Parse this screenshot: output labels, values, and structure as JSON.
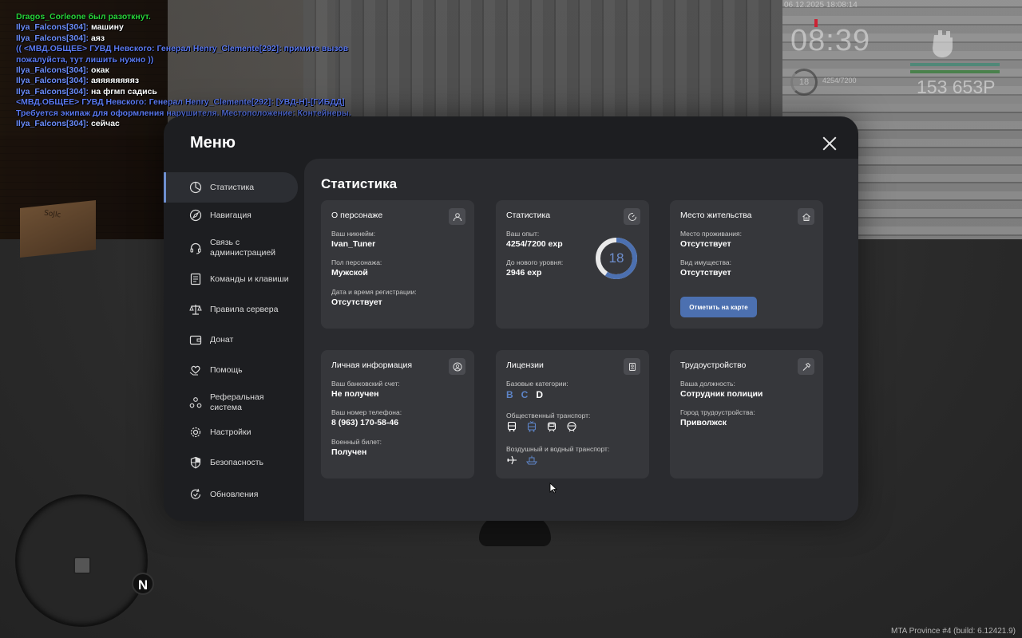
{
  "chat": [
    {
      "segments": [
        {
          "text": "Dragos_Corleone был разоткнут.",
          "color": "green"
        }
      ]
    },
    {
      "segments": [
        {
          "text": "Ilya_Falcons[304]: ",
          "color": "blue"
        },
        {
          "text": "машину",
          "color": "white"
        }
      ]
    },
    {
      "segments": [
        {
          "text": "Ilya_Falcons[304]: ",
          "color": "blue"
        },
        {
          "text": "аяз",
          "color": "white"
        }
      ]
    },
    {
      "segments": [
        {
          "text": "(( <МВД.ОБЩЕЕ> ГУВД Невского: Генерал Henry_Clemente[292]: примите вызов",
          "color": "gov"
        }
      ]
    },
    {
      "segments": [
        {
          "text": "пожалуйста, тут лишить нужно ))",
          "color": "gov"
        }
      ]
    },
    {
      "segments": [
        {
          "text": "Ilya_Falcons[304]: ",
          "color": "blue"
        },
        {
          "text": "окак",
          "color": "white"
        }
      ]
    },
    {
      "segments": [
        {
          "text": "Ilya_Falcons[304]: ",
          "color": "blue"
        },
        {
          "text": "аяяяяяяяяз",
          "color": "white"
        }
      ]
    },
    {
      "segments": [
        {
          "text": "Ilya_Falcons[304]: ",
          "color": "blue"
        },
        {
          "text": "на фгмп садись",
          "color": "white"
        }
      ]
    },
    {
      "segments": [
        {
          "text": "<МВД.ОБЩЕЕ> ГУВД Невского: Генерал Henry_Clemente[292]: [УВД-Н]-[ГИБДД]",
          "color": "gov"
        }
      ]
    },
    {
      "segments": [
        {
          "text": "Требуется экипаж для оформления нарушителя. Местоположение: Контейнеры.",
          "color": "gov"
        }
      ]
    },
    {
      "segments": [
        {
          "text": "Ilya_Falcons[304]: ",
          "color": "blue"
        },
        {
          "text": "сейчас",
          "color": "white"
        }
      ]
    }
  ],
  "hud": {
    "date": "06.12.2025 18:08:14",
    "time": "08:39",
    "level": "18",
    "exp": "4254/7200",
    "money": "153 653Р"
  },
  "build_info": "MTA Province #4 (build: 6.12421.9)",
  "scene": {
    "box_label": "SoJlc"
  },
  "menu": {
    "title": "Меню",
    "nav": [
      {
        "label": "Статистика",
        "icon": "pie-chart-icon",
        "active": true
      },
      {
        "label": "Навигация",
        "icon": "compass-icon"
      },
      {
        "label": "Связь с администрацией",
        "icon": "headset-icon"
      },
      {
        "label": "Команды и клавиши",
        "icon": "document-icon"
      },
      {
        "label": "Правила сервера",
        "icon": "scales-icon"
      },
      {
        "label": "Донат",
        "icon": "wallet-icon"
      },
      {
        "label": "Помощь",
        "icon": "heart-hand-icon"
      },
      {
        "label": "Реферальная система",
        "icon": "people-icon"
      },
      {
        "label": "Настройки",
        "icon": "gear-icon"
      },
      {
        "label": "Безопасность",
        "icon": "shield-icon"
      },
      {
        "label": "Обновления",
        "icon": "refresh-check-icon"
      }
    ],
    "content_title": "Статистика",
    "cards": {
      "character": {
        "title": "О персонаже",
        "fields": [
          {
            "label": "Ваш никнейм:",
            "value": "Ivan_Tuner"
          },
          {
            "label": "Пол персонажа:",
            "value": "Мужской"
          },
          {
            "label": "Дата и время регистрации:",
            "value": "Отсутствует"
          }
        ]
      },
      "stats": {
        "title": "Статистика",
        "exp_label": "Ваш опыт:",
        "exp_value": "4254/7200 exp",
        "next_label": "До нового уровня:",
        "next_value": "2946 exp",
        "level": "18",
        "exp_current": 4254,
        "exp_total": 7200
      },
      "residence": {
        "title": "Место жительства",
        "fields": [
          {
            "label": "Место проживания:",
            "value": "Отсутствует"
          },
          {
            "label": "Вид имущества:",
            "value": "Отсутствует"
          }
        ],
        "button": "Отметить на карте"
      },
      "personal": {
        "title": "Личная информация",
        "fields": [
          {
            "label": "Ваш банковский счет:",
            "value": "Не получен"
          },
          {
            "label": "Ваш номер телефона:",
            "value": "8 (963) 170-58-46"
          },
          {
            "label": "Военный билет:",
            "value": "Получен"
          }
        ]
      },
      "licenses": {
        "title": "Лицензии",
        "base_label": "Базовые категории:",
        "categories": [
          {
            "letter": "B",
            "owned": false
          },
          {
            "letter": "C",
            "owned": false
          },
          {
            "letter": "D",
            "owned": true
          }
        ],
        "public_label": "Общественный транспорт:",
        "public_icons": [
          {
            "name": "bus-icon",
            "owned": false
          },
          {
            "name": "trolleybus-icon",
            "owned": true
          },
          {
            "name": "tram-icon",
            "owned": false
          },
          {
            "name": "metro-icon",
            "owned": false
          }
        ],
        "air_label": "Воздушный и водный транспорт:",
        "air_icons": [
          {
            "name": "plane-icon",
            "owned": false
          },
          {
            "name": "boat-icon",
            "owned": true
          }
        ]
      },
      "employment": {
        "title": "Трудоустройство",
        "fields": [
          {
            "label": "Ваша должность:",
            "value": "Сотрудник полиции"
          },
          {
            "label": "Город трудоустройства:",
            "value": "Приволжск"
          }
        ]
      }
    }
  },
  "colors": {
    "accent": "#6e8fcf",
    "button": "#4c70b0",
    "license_inactive": "#5d84c7"
  }
}
